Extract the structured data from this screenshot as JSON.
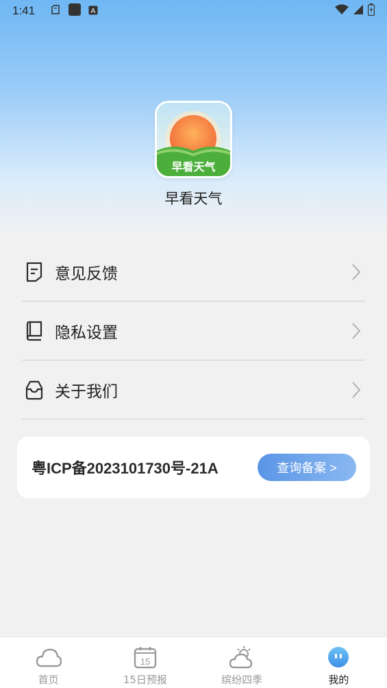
{
  "status_bar": {
    "time": "1:41",
    "left_icons": [
      "clipboard-icon",
      "app-square-icon",
      "keyboard-a-icon"
    ],
    "right_icons": [
      "wifi-icon",
      "signal-icon",
      "battery-charging-icon"
    ]
  },
  "app": {
    "name": "早看天气",
    "logo_text": "早看天气",
    "logo_icon": "sunrise-logo-icon"
  },
  "menu": {
    "items": [
      {
        "label": "意见反馈",
        "icon": "feedback-note-icon"
      },
      {
        "label": "隐私设置",
        "icon": "book-icon"
      },
      {
        "label": "关于我们",
        "icon": "inbox-icon"
      }
    ]
  },
  "icp": {
    "text": "粤ICP备2023101730号-21A",
    "button_label": "查询备案 >"
  },
  "tabbar": {
    "tabs": [
      {
        "label": "首页",
        "icon": "cloud-icon",
        "active": false
      },
      {
        "label": "15日预报",
        "icon": "calendar-15-icon",
        "active": false
      },
      {
        "label": "缤纷四季",
        "icon": "sun-cloud-icon",
        "active": false
      },
      {
        "label": "我的",
        "icon": "profile-face-icon",
        "active": true
      }
    ]
  },
  "colors": {
    "accent_blue": "#5a95e6",
    "tab_active": "#222222",
    "tab_inactive": "#999999",
    "background": "#f1f1f1"
  }
}
